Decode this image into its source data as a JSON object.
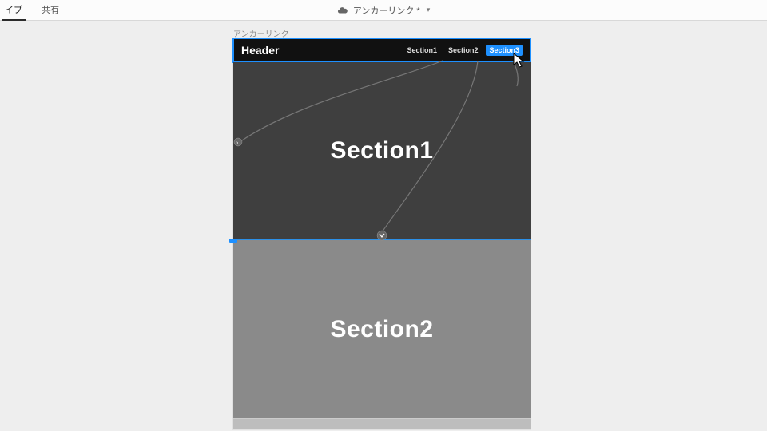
{
  "appbar": {
    "left": {
      "item1": "イブ",
      "item2": "共有"
    },
    "doc_title": "アンカーリンク *"
  },
  "artboard": {
    "label": "アンカーリンク",
    "header": {
      "title": "Header",
      "nav": {
        "link1": "Section1",
        "link2": "Section2",
        "link3": "Section3"
      }
    },
    "sections": {
      "s1": "Section1",
      "s2": "Section2"
    }
  }
}
